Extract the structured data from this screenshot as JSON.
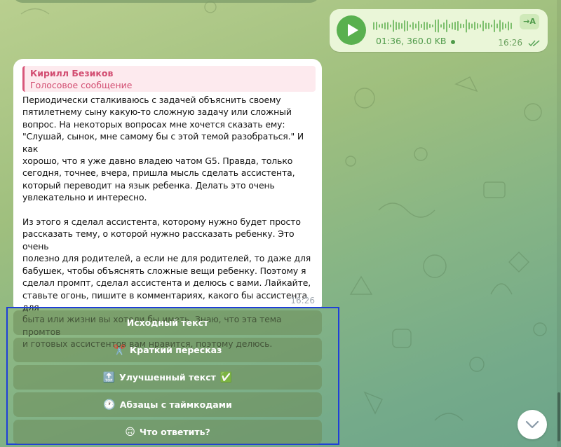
{
  "voice_message": {
    "meta": "01:36, 360.0 KB",
    "time": "16:26",
    "transcribe_label": "→A",
    "accent_color": "#59b04f"
  },
  "message": {
    "reply_name": "Кирилл Безиков",
    "reply_subtitle": "Голосовое сообщение",
    "text": "Периодически сталкиваюсь с задачей объяснить своему\nпятилетнему сыну какую-то сложную задачу или сложный\nвопрос. На некоторых вопросах мне хочется сказать ему:\n\"Слушай, сынок, мне самому бы с этой темой разобраться.\" И как\nхорошо, что я уже давно владею чатом G5. Правда, только\nсегодня, точнее, вчера, пришла мысль сделать ассистента,\nкоторый переводит на язык ребенка. Делать это очень\nувлекательно и интересно.\n\nИз этого я сделал ассистента, которому нужно будет просто\nрассказать тему, о которой нужно рассказать ребенку. Это очень\nполезно для родителей, а если не для родителей, то даже для\nбабушек, чтобы объяснять сложные вещи ребенку. Поэтому я\nсделал промпт, сделал ассистента и делюсь с вами. Лайкайте,\nставьте огонь, пишите в комментариях, какого бы ассистента для\nбыта или жизни вы хотели бы иметь. Знаю, что эта тема промтов\nи готовых ассистентов вам нравится, поэтому делюсь.",
    "time": "16:26"
  },
  "keyboard": {
    "buttons": [
      {
        "icon": "",
        "label": "Исходный текст"
      },
      {
        "icon": "✂️",
        "label": "Краткий пересказ"
      },
      {
        "icon": "🔝",
        "label": "Улучшенный текст"
      },
      {
        "icon": "🕐",
        "label": "Абзацы с таймкодами"
      },
      {
        "icon": "🙃",
        "label": "Что ответить?"
      }
    ],
    "suffix_3": "✅"
  }
}
